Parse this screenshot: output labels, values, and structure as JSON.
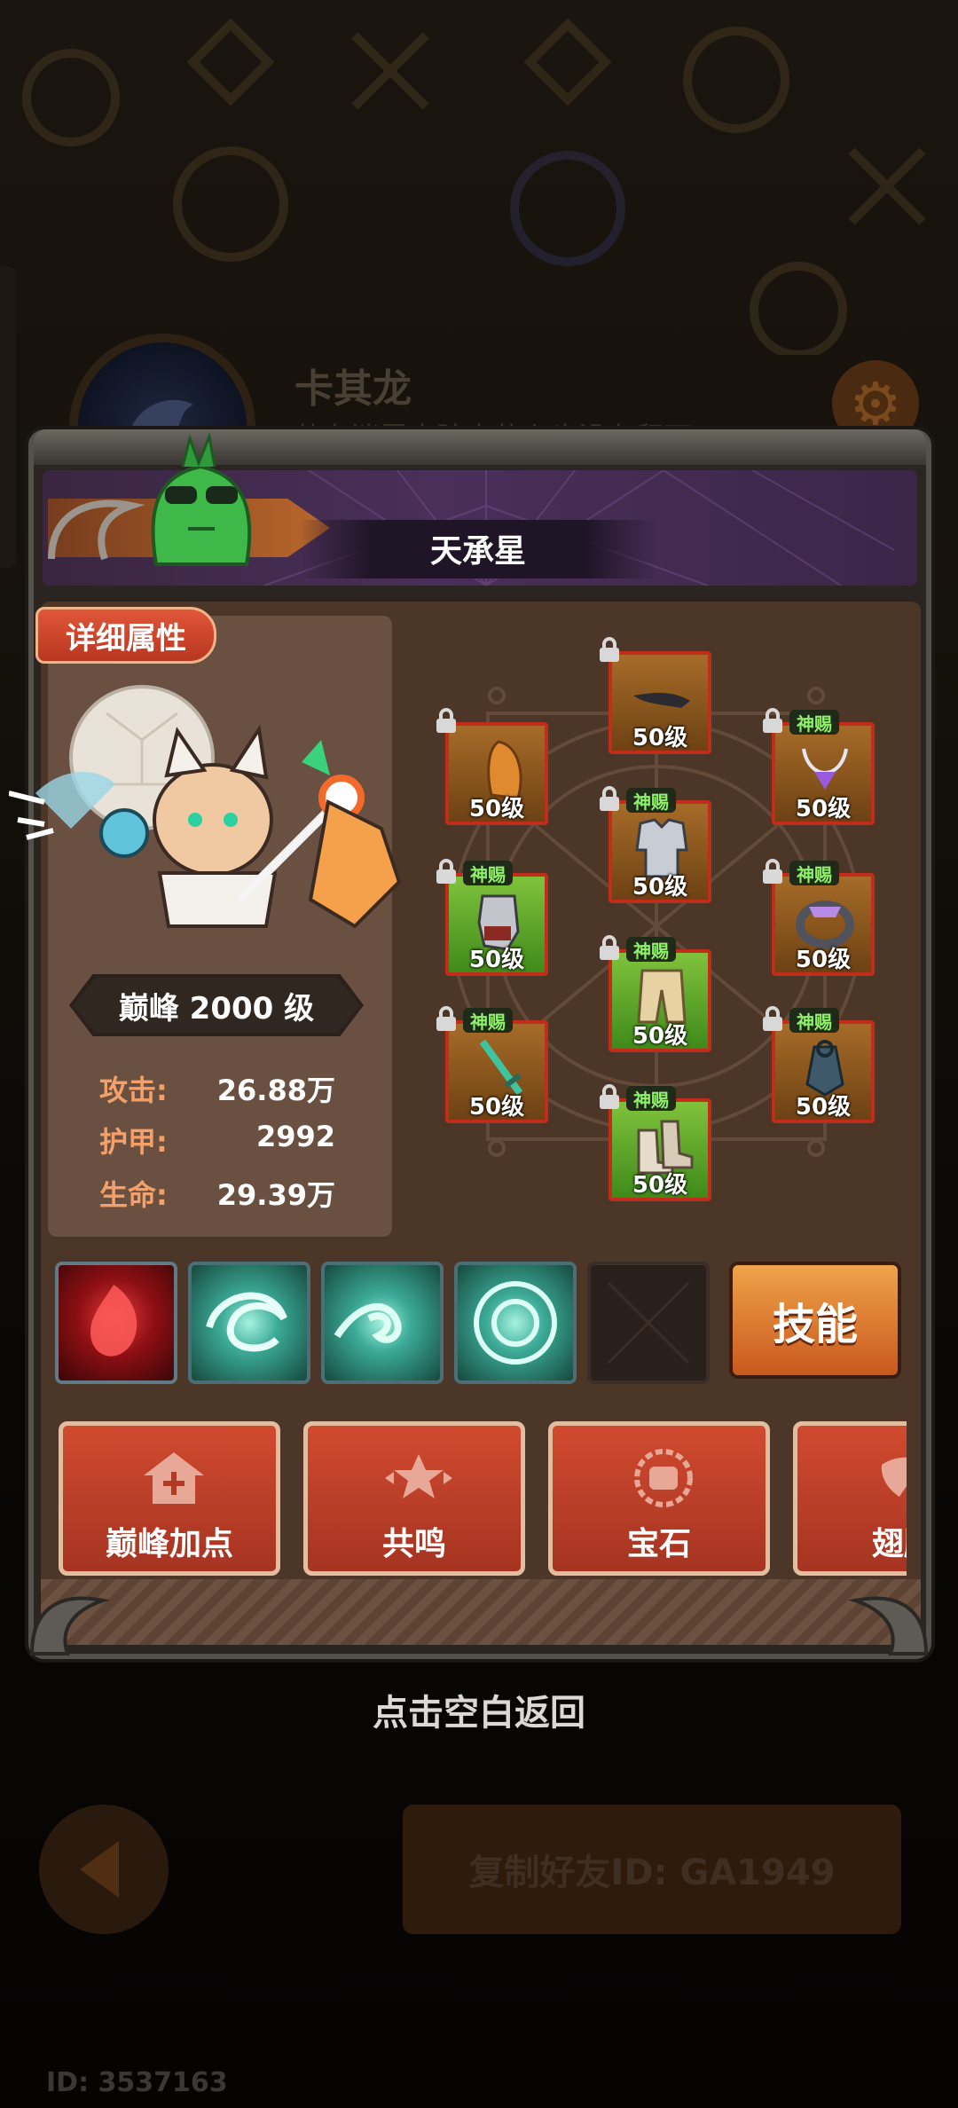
{
  "background": {
    "player_name": "卡其龙",
    "player_motto": "他在迷雾大陆中什么也没有留下",
    "copy_friend_label": "复制好友ID: GA1949",
    "uid_label": "ID: 3537163",
    "hint": "点击空白返回"
  },
  "panel": {
    "title": "天承星",
    "detail_badge": "详细属性",
    "level_label": "巅峰 2000 级",
    "stats": [
      {
        "label": "攻击:",
        "value": "26.88万"
      },
      {
        "label": "护甲:",
        "value": "2992"
      },
      {
        "label": "生命:",
        "value": "29.39万"
      }
    ]
  },
  "equipment": [
    {
      "slot": "top-center",
      "level": "50级",
      "gift": "",
      "rarity": "gold",
      "icon": "cape-icon"
    },
    {
      "slot": "left-1",
      "level": "50级",
      "gift": "",
      "rarity": "gold",
      "icon": "hood-icon"
    },
    {
      "slot": "right-1",
      "level": "50级",
      "gift": "神赐",
      "rarity": "gold",
      "icon": "necklace-icon"
    },
    {
      "slot": "center-2",
      "level": "50级",
      "gift": "神赐",
      "rarity": "gold",
      "icon": "armor-icon"
    },
    {
      "slot": "left-2",
      "level": "50级",
      "gift": "神赐",
      "rarity": "green",
      "icon": "gauntlet-icon"
    },
    {
      "slot": "right-2",
      "level": "50级",
      "gift": "神赐",
      "rarity": "gold",
      "icon": "ring-icon"
    },
    {
      "slot": "center-3",
      "level": "50级",
      "gift": "神赐",
      "rarity": "green",
      "icon": "pants-icon"
    },
    {
      "slot": "left-3",
      "level": "50级",
      "gift": "神赐",
      "rarity": "gold",
      "icon": "sword-icon"
    },
    {
      "slot": "right-3",
      "level": "50级",
      "gift": "神赐",
      "rarity": "gold",
      "icon": "amulet-icon"
    },
    {
      "slot": "center-4",
      "level": "50级",
      "gift": "神赐",
      "rarity": "green",
      "icon": "boots-icon"
    }
  ],
  "skills": {
    "button_label": "技能",
    "slots": [
      "blood-drop-skill-icon",
      "vortex-skill-icon",
      "wind-wave-skill-icon",
      "whirlpool-skill-icon",
      "empty-skill-slot"
    ]
  },
  "functions": [
    {
      "label": "巅峰加点",
      "icon": "plus-house-icon"
    },
    {
      "label": "共鸣",
      "icon": "resonance-star-icon"
    },
    {
      "label": "宝石",
      "icon": "gem-icon"
    },
    {
      "label": "翅膀",
      "icon": "wing-icon"
    }
  ],
  "colors": {
    "accent_red": "#c22c1a",
    "stat_label": "#f4a06a",
    "gift_text": "#8ff26a",
    "skill_button": "#e07a30"
  }
}
